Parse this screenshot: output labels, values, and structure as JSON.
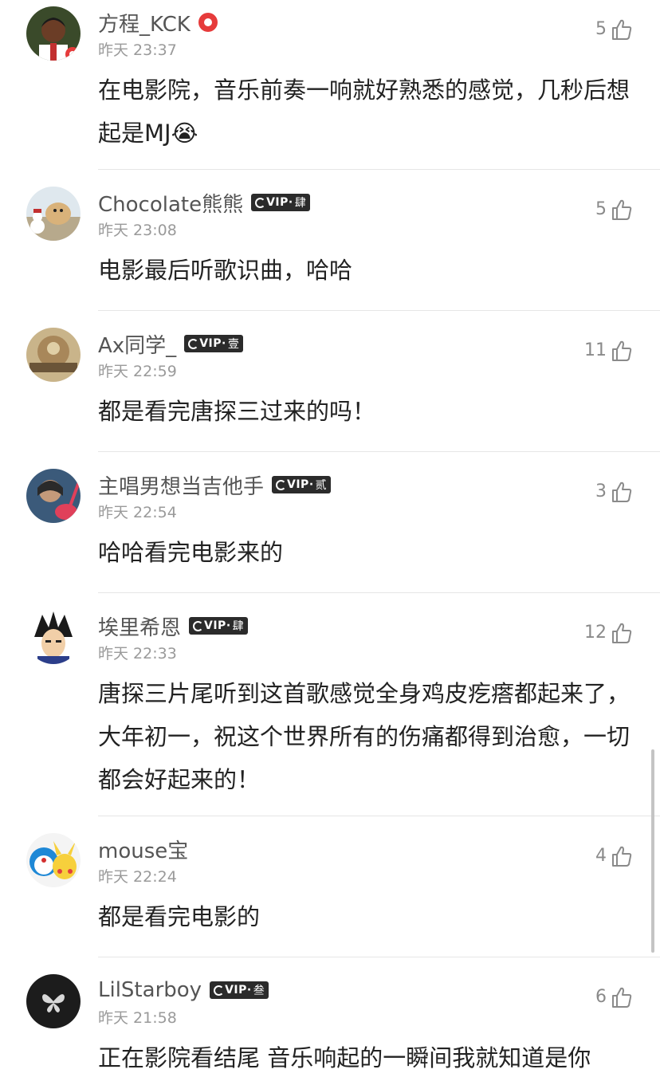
{
  "comments": [
    {
      "username": "方程_KCK",
      "badge_level": "",
      "time": "昨天 23:37",
      "likes": "5",
      "content": "在电影院，音乐前奏一响就好熟悉的感觉，几秒后想起是MJ😭",
      "avatar_icon": "person-avatar-icon"
    },
    {
      "username": "Chocolate熊熊",
      "badge_level": "肆",
      "time": "昨天 23:08",
      "likes": "5",
      "content": "电影最后听歌识曲，哈哈",
      "avatar_icon": "dog-snowman-avatar-icon"
    },
    {
      "username": "Ax同学_",
      "badge_level": "壹",
      "time": "昨天 22:59",
      "likes": "11",
      "content": "都是看完唐探三过来的吗！",
      "avatar_icon": "vintage-photo-avatar-icon"
    },
    {
      "username": "主唱男想当吉他手",
      "badge_level": "贰",
      "time": "昨天 22:54",
      "likes": "3",
      "content": "哈哈看完电影来的",
      "avatar_icon": "guitar-avatar-icon"
    },
    {
      "username": "埃里希恩",
      "badge_level": "肆",
      "time": "昨天 22:33",
      "likes": "12",
      "content": "唐探三片尾听到这首歌感觉全身鸡皮疙瘩都起来了，大年初一，祝这个世界所有的伤痛都得到治愈，一切都会好起来的！",
      "avatar_icon": "anime-character-avatar-icon"
    },
    {
      "username": "mouse宝",
      "badge_level": "",
      "time": "昨天 22:24",
      "likes": "4",
      "content": "都是看完电影的",
      "avatar_icon": "cartoon-avatar-icon"
    },
    {
      "username": "LilStarboy",
      "badge_level": "叁",
      "time": "昨天 21:58",
      "likes": "6",
      "content": "正在影院看结尾 音乐响起的一瞬间我就知道是你",
      "avatar_icon": "butterfly-avatar-icon"
    }
  ],
  "vip_label": "VIP·",
  "colors": {
    "username": "#555555",
    "time": "#9a9a9a",
    "content": "#222222",
    "badge_bg": "#2b2b2b",
    "record_icon": "#e63b3b"
  }
}
